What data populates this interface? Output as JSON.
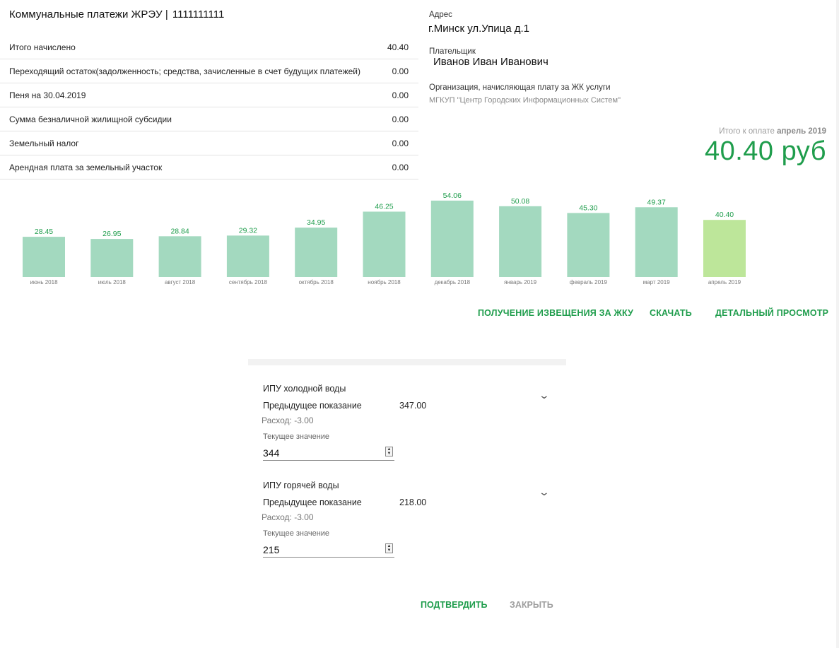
{
  "header": {
    "title": "Коммунальные платежи ЖРЭУ |",
    "account": "1111111111"
  },
  "summary": {
    "rows": [
      {
        "label": "Итого начислено",
        "value": "40.40"
      },
      {
        "label": "Переходящий остаток(задолженность; средства, зачисленные в счет будущих платежей)",
        "value": "0.00"
      },
      {
        "label": "Пеня на 30.04.2019",
        "value": "0.00"
      },
      {
        "label": "Сумма безналичной жилищной субсидии",
        "value": "0.00"
      },
      {
        "label": "Земельный налог",
        "value": "0.00"
      },
      {
        "label": "Арендная плата за земельный участок",
        "value": "0.00"
      }
    ]
  },
  "info": {
    "address_label": "Адрес",
    "address_value": "г.Минск ул.Упица д.1",
    "payer_label": "Плательщик",
    "payer_value": "Иванов Иван Иванович",
    "org_label": "Организация, начисляющая плату за ЖК услуги",
    "org_value": "МГКУП \"Центр Городских Информационных Систем\""
  },
  "total": {
    "caption": "Итого к оплате",
    "period": "апрель 2019",
    "amount": "40.40 руб"
  },
  "chart_data": {
    "type": "bar",
    "categories": [
      "июнь 2018",
      "июль 2018",
      "август 2018",
      "сентябрь 2018",
      "октябрь 2018",
      "ноябрь 2018",
      "декабрь 2018",
      "январь 2019",
      "февраль 2019",
      "март 2019",
      "апрель 2019"
    ],
    "values": [
      28.45,
      26.95,
      28.84,
      29.32,
      34.95,
      46.25,
      54.06,
      50.08,
      45.3,
      49.37,
      40.4
    ],
    "labels": [
      "28.45",
      "26.95",
      "28.84",
      "29.32",
      "34.95",
      "46.25",
      "54.06",
      "50.08",
      "45.30",
      "49.37",
      "40.40"
    ],
    "highlight_index": 10,
    "colors": {
      "bar": "#a3d9bf",
      "highlight": "#bde69a",
      "label": "#1f9d4c"
    }
  },
  "actions": {
    "notice": "Получение извещения за ЖКУ",
    "download": "Скачать",
    "details": "Детальный просмотр"
  },
  "meters": [
    {
      "title": "ИПУ холодной воды",
      "prev_label": "Предыдущее показание",
      "prev_value": "347.00",
      "usage": "Расход: -3.00",
      "current_label": "Текущее значение",
      "current_value": "344"
    },
    {
      "title": "ИПУ горячей воды",
      "prev_label": "Предыдущее показание",
      "prev_value": "218.00",
      "usage": "Расход: -3.00",
      "current_label": "Текущее значение",
      "current_value": "215"
    }
  ],
  "dialog": {
    "confirm": "ПОДТВЕРДИТЬ",
    "close": "ЗАКРЫТЬ"
  },
  "theme": {
    "accent": "#1f9d4c"
  }
}
